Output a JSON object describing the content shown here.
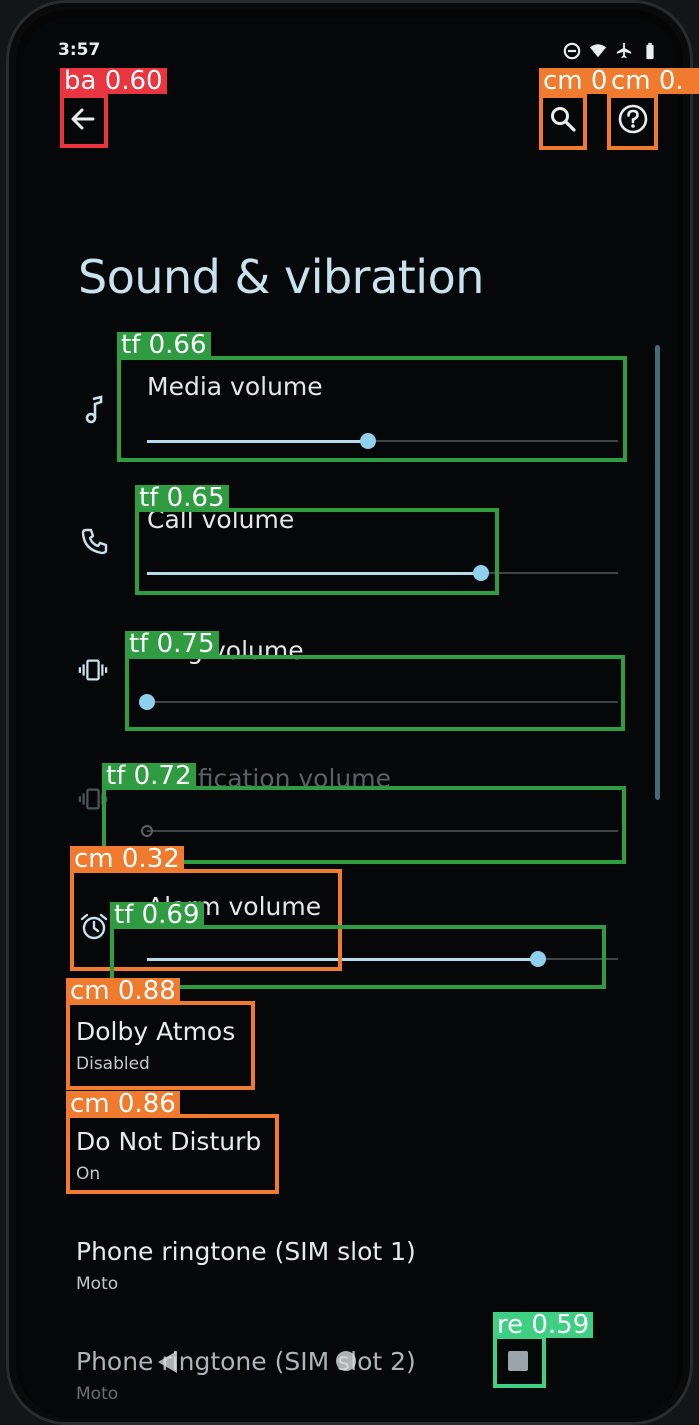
{
  "status_bar": {
    "time": "3:57",
    "icons": [
      "do-not-disturb-icon",
      "wifi-icon",
      "airplane-icon",
      "battery-icon"
    ]
  },
  "header": {
    "title": "Sound & vibration",
    "back_icon": "arrow-left-icon",
    "search_icon": "search-icon",
    "help_icon": "help-icon"
  },
  "volumes": [
    {
      "label": "Media volume",
      "icon": "music-note-icon",
      "level": 0.47
    },
    {
      "label": "Call volume",
      "icon": "phone-icon",
      "level": 0.71
    },
    {
      "label": "Ring volume",
      "icon": "vibrate-icon",
      "level": 0.0
    },
    {
      "label": "Notification volume",
      "icon": "vibrate-icon",
      "level": 0.0
    },
    {
      "label": "Alarm volume",
      "icon": "alarm-icon",
      "level": 0.83
    }
  ],
  "settings": [
    {
      "title": "Dolby Atmos",
      "subtitle": "Disabled"
    },
    {
      "title": "Do Not Disturb",
      "subtitle": "On"
    },
    {
      "title": "Phone ringtone (SIM slot 1)",
      "subtitle": "Moto"
    },
    {
      "title": "Phone ringtone (SIM slot 2)",
      "subtitle": "Moto"
    }
  ],
  "detections": [
    {
      "tag": "ba 0.60",
      "color": "red"
    },
    {
      "tag": "cm 0.",
      "color": "orange"
    },
    {
      "tag": "cm 0.",
      "color": "orange"
    },
    {
      "tag": "tf 0.66",
      "color": "green"
    },
    {
      "tag": "tf 0.65",
      "color": "green"
    },
    {
      "tag": "tf 0.75",
      "color": "green"
    },
    {
      "tag": "tf 0.72",
      "color": "green"
    },
    {
      "tag": "cm 0.32",
      "color": "orange"
    },
    {
      "tag": "tf 0.69",
      "color": "green"
    },
    {
      "tag": "cm 0.88",
      "color": "orange"
    },
    {
      "tag": "cm 0.86",
      "color": "orange"
    },
    {
      "tag": "re 0.59",
      "color": "mint"
    }
  ]
}
